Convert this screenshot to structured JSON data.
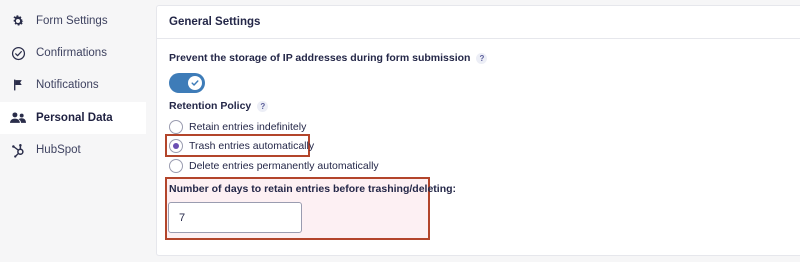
{
  "sidebar": {
    "items": [
      {
        "label": "Form Settings",
        "icon": "gear-icon"
      },
      {
        "label": "Confirmations",
        "icon": "check-circle-icon"
      },
      {
        "label": "Notifications",
        "icon": "flag-icon"
      },
      {
        "label": "Personal Data",
        "icon": "users-icon",
        "active": true
      },
      {
        "label": "HubSpot",
        "icon": "hubspot-icon"
      }
    ]
  },
  "panel": {
    "title": "General Settings",
    "ip_label": "Prevent the storage of IP addresses during form submission",
    "ip_help": "?",
    "ip_toggle_on": true,
    "retention_label": "Retention Policy",
    "retention_help": "?",
    "retention_options": [
      {
        "label": "Retain entries indefinitely",
        "checked": false
      },
      {
        "label": "Trash entries automatically",
        "checked": true
      },
      {
        "label": "Delete entries permanently automatically",
        "checked": false
      }
    ],
    "days_label": "Number of days to retain entries before trashing/deleting:",
    "days_value": "7"
  },
  "colors": {
    "accent": "#3e7cb8",
    "radio_checked": "#6b4fb2",
    "highlight_border": "#b3452b",
    "highlight_fill": "#fdf0f3"
  }
}
